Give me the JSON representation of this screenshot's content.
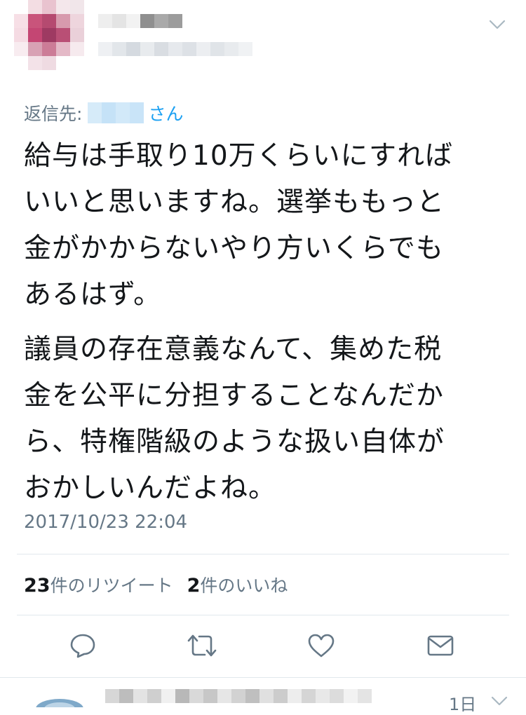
{
  "reply_to": {
    "label": "返信先:",
    "suffix": "さん"
  },
  "tweet": {
    "paragraphs": [
      "給与は手取り10万くらいにすれば\nいいと思いますね。選挙ももっと\n金がかからないやり方いくらでも\nあるはず。",
      "議員の存在意義なんて、集めた税\n金を公平に分担することなんだか\nら、特権階級のような扱い自体が\nおかしいんだよね。"
    ],
    "timestamp": "2017/10/23 22:04"
  },
  "stats": {
    "retweet_count": "23",
    "retweet_label": "件のリツイート",
    "like_count": "2",
    "like_label": "件のいいね"
  },
  "actions": {
    "reply_icon": "reply-icon",
    "retweet_icon": "retweet-icon",
    "like_icon": "heart-icon",
    "dm_icon": "envelope-icon"
  },
  "next_tweet": {
    "time": "1日"
  },
  "colors": {
    "text": "#14171a",
    "muted": "#657786",
    "link": "#1da1f2",
    "divider": "#e1e8ed"
  }
}
